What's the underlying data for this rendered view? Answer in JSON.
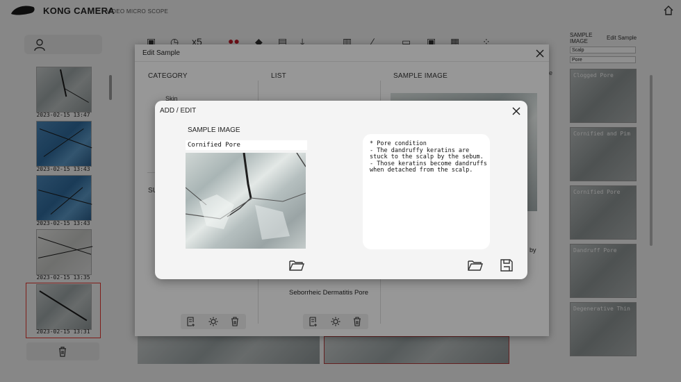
{
  "app": {
    "brand": "KONG CAMERA",
    "brand_sub": "VIDEO MICRO SCOPE"
  },
  "timeline": {
    "items": [
      {
        "time": "2023-02-15 13:47",
        "type": "gray"
      },
      {
        "time": "2023-02-15 13:43",
        "type": "blue"
      },
      {
        "time": "2023-02-15 13:43",
        "type": "blue"
      },
      {
        "time": "2023-02-15 13:35",
        "type": "white"
      },
      {
        "time": "2023-02-15 13:31",
        "type": "gray"
      }
    ]
  },
  "right_panel": {
    "sample_image_label": "SAMPLE IMAGE",
    "edit_sample_link": "Edit Sample",
    "category_select": "Scalp",
    "subcategory_select": "Pore",
    "thumbs": [
      {
        "label": "Clogged Pore"
      },
      {
        "label": "Cornified and Pim"
      },
      {
        "label": "Cornified Pore"
      },
      {
        "label": "Dandruff Pore"
      },
      {
        "label": "Degenerative Thin"
      }
    ]
  },
  "edit_sample": {
    "title": "Edit Sample",
    "category_header": "CATEGORY",
    "list_header": "LIST",
    "sample_image_header": "SAMPLE IMAGE",
    "category_item": "Skin",
    "sub_header_partial": "SU",
    "list_item_visible": "Seborrheic Dermatitis Pore",
    "side_fragment_e": "e",
    "side_fragment_by": "by"
  },
  "add_edit": {
    "title": "ADD / EDIT",
    "sample_image_label": "SAMPLE IMAGE",
    "sample_name": "Cornified Pore",
    "description": "* Pore condition\n- The dandruffy keratins are stuck to the scalp by the sebum.\n- Those keratins become dandruffs when detached from the scalp."
  },
  "colors": {
    "highlight": "#e0342e",
    "accent_red": "#b33a3a"
  }
}
